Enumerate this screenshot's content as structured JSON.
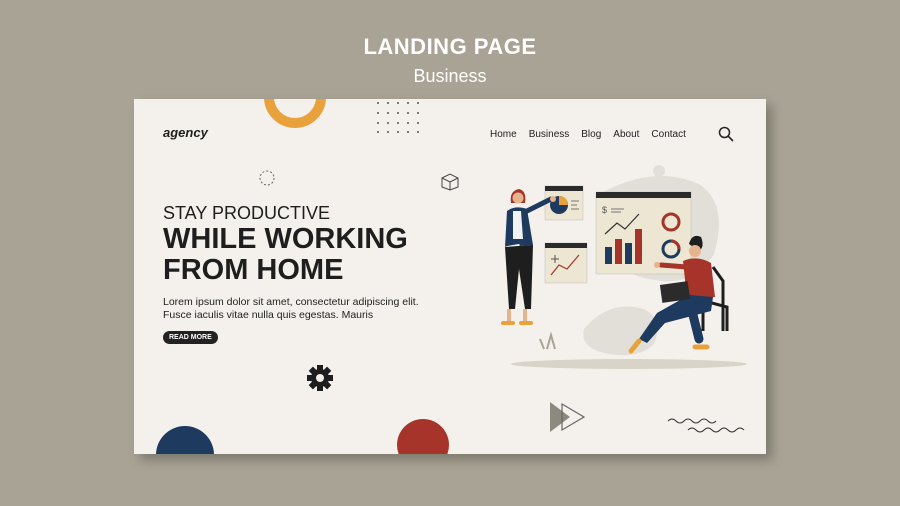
{
  "banner": {
    "title": "LANDING PAGE",
    "subtitle": "Business"
  },
  "header": {
    "logo": "agency",
    "nav": [
      "Home",
      "Business",
      "Blog",
      "About",
      "Contact"
    ]
  },
  "hero": {
    "kicker": "STAY PRODUCTIVE",
    "headline": "WHILE WORKING FROM HOME",
    "body": "Lorem ipsum dolor sit amet, consectetur adipiscing elit. Fusce iaculis vitae nulla quis egestas. Mauris",
    "cta": "READ MORE"
  },
  "illustration": {
    "board_currency_symbol": "$"
  },
  "colors": {
    "background": "#a9a395",
    "card": "#f4f1ec",
    "orange": "#e9a23b",
    "navy": "#1f3a5f",
    "red": "#a6342a",
    "dark": "#1e1e1e"
  }
}
